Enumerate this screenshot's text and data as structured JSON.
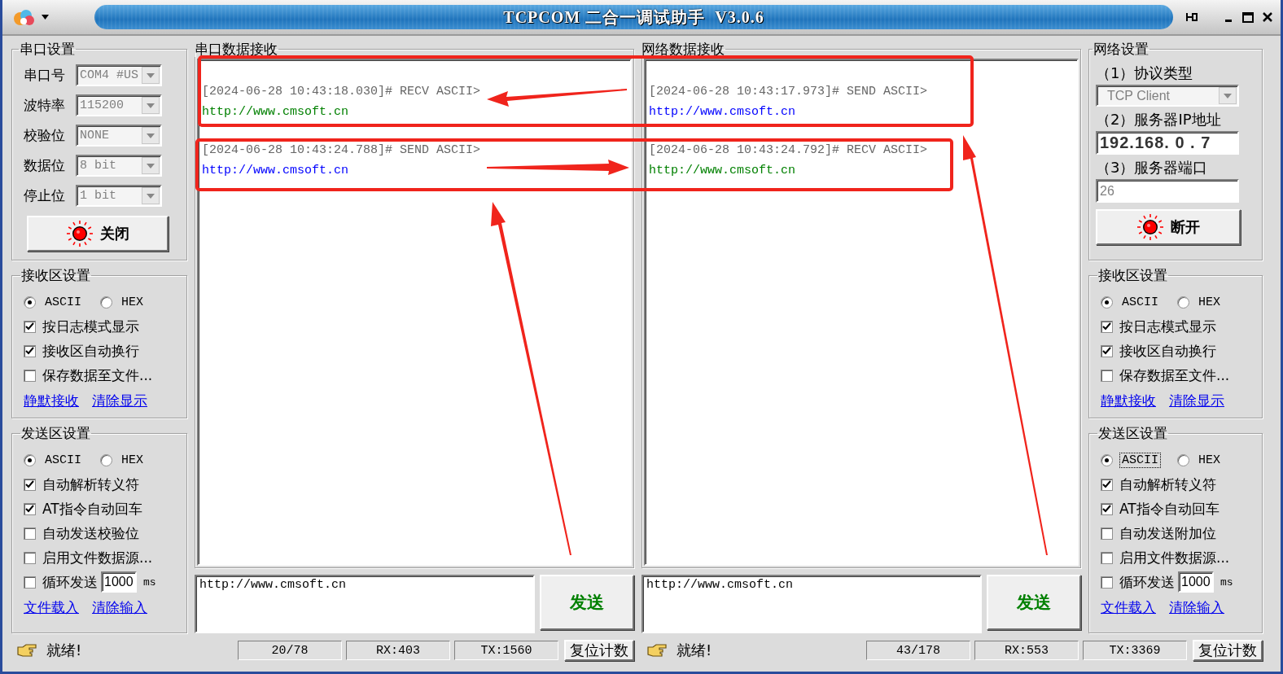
{
  "window": {
    "title": "TCPCOM 二合一调试助手  V3.0.6"
  },
  "serial_settings": {
    "title": "串口设置",
    "fields": [
      {
        "label": "串口号",
        "value": "COM4 #US"
      },
      {
        "label": "波特率",
        "value": "115200"
      },
      {
        "label": "校验位",
        "value": "NONE"
      },
      {
        "label": "数据位",
        "value": "8 bit"
      },
      {
        "label": "停止位",
        "value": "1 bit"
      }
    ],
    "button": "关闭"
  },
  "serial_receive_settings": {
    "title": "接收区设置",
    "modes": [
      {
        "label": "ASCII",
        "selected": true,
        "focused": false
      },
      {
        "label": "HEX",
        "selected": false,
        "focused": false
      }
    ],
    "options": [
      {
        "kind": "checkbox",
        "label": "按日志模式显示",
        "checked": true
      },
      {
        "kind": "checkbox",
        "label": "接收区自动换行",
        "checked": true
      },
      {
        "kind": "checkbox",
        "label": "保存数据至文件...",
        "checked": false
      }
    ],
    "links": [
      "静默接收",
      "清除显示"
    ]
  },
  "serial_send_settings": {
    "title": "发送区设置",
    "modes": [
      {
        "label": "ASCII",
        "selected": true,
        "focused": false
      },
      {
        "label": "HEX",
        "selected": false,
        "focused": false
      }
    ],
    "options": [
      {
        "kind": "checkbox",
        "label": "自动解析转义符",
        "checked": true
      },
      {
        "kind": "checkbox",
        "label": "AT指令自动回车",
        "checked": true
      },
      {
        "kind": "checkbox",
        "label": "自动发送校验位",
        "checked": false
      },
      {
        "kind": "checkbox",
        "label": "启用文件数据源...",
        "checked": false
      },
      {
        "kind": "interval",
        "label": "循环发送",
        "checked": false,
        "value": "1000",
        "unit": "ms"
      }
    ],
    "links": [
      "文件载入",
      "清除输入"
    ]
  },
  "serial_receive": {
    "title": "串口数据接收",
    "entries": [
      {
        "color": "#008000",
        "header": "[2024-06-28 10:43:18.030]# RECV ASCII>",
        "body": "http://www.cmsoft.cn"
      },
      {
        "color": "#0000ff",
        "header": "[2024-06-28 10:43:24.788]# SEND ASCII>",
        "body": "http://www.cmsoft.cn"
      }
    ]
  },
  "serial_send": {
    "value": "http://www.cmsoft.cn",
    "button": "发送"
  },
  "serial_status": {
    "message": "就绪!",
    "counters": [
      "20/78",
      "RX:403",
      "TX:1560"
    ],
    "reset_button": "复位计数"
  },
  "network_receive": {
    "title": "网络数据接收",
    "entries": [
      {
        "color": "#0000ff",
        "header": "[2024-06-28 10:43:17.973]# SEND ASCII>",
        "body": "http://www.cmsoft.cn"
      },
      {
        "color": "#008000",
        "header": "[2024-06-28 10:43:24.792]# RECV ASCII>",
        "body": "http://www.cmsoft.cn"
      }
    ]
  },
  "network_send": {
    "value": "http://www.cmsoft.cn",
    "button": "发送"
  },
  "network_status": {
    "message": "就绪!",
    "counters": [
      "43/178",
      "RX:553",
      "TX:3369"
    ],
    "reset_button": "复位计数"
  },
  "network_settings": {
    "title": "网络设置",
    "protocol_label": "（1）协议类型",
    "protocol": "TCP Client",
    "ip_label": "（2）服务器IP地址",
    "ip": "192.168. 0 . 7",
    "port_label": "（3）服务器端口",
    "port": "26",
    "button": "断开"
  },
  "network_receive_settings": {
    "title": "接收区设置",
    "modes": [
      {
        "label": "ASCII",
        "selected": true,
        "focused": false
      },
      {
        "label": "HEX",
        "selected": false,
        "focused": false
      }
    ],
    "options": [
      {
        "kind": "checkbox",
        "label": "按日志模式显示",
        "checked": true
      },
      {
        "kind": "checkbox",
        "label": "接收区自动换行",
        "checked": true
      },
      {
        "kind": "checkbox",
        "label": "保存数据至文件...",
        "checked": false
      }
    ],
    "links": [
      "静默接收",
      "清除显示"
    ]
  },
  "network_send_settings": {
    "title": "发送区设置",
    "modes": [
      {
        "label": "ASCII",
        "selected": true,
        "focused": true
      },
      {
        "label": "HEX",
        "selected": false,
        "focused": false
      }
    ],
    "options": [
      {
        "kind": "checkbox",
        "label": "自动解析转义符",
        "checked": true
      },
      {
        "kind": "checkbox",
        "label": "AT指令自动回车",
        "checked": true
      },
      {
        "kind": "checkbox",
        "label": "自动发送附加位",
        "checked": false
      },
      {
        "kind": "checkbox",
        "label": "启用文件数据源...",
        "checked": false
      },
      {
        "kind": "interval",
        "label": "循环发送",
        "checked": false,
        "value": "1000",
        "unit": "ms"
      }
    ],
    "links": [
      "文件载入",
      "清除输入"
    ]
  }
}
